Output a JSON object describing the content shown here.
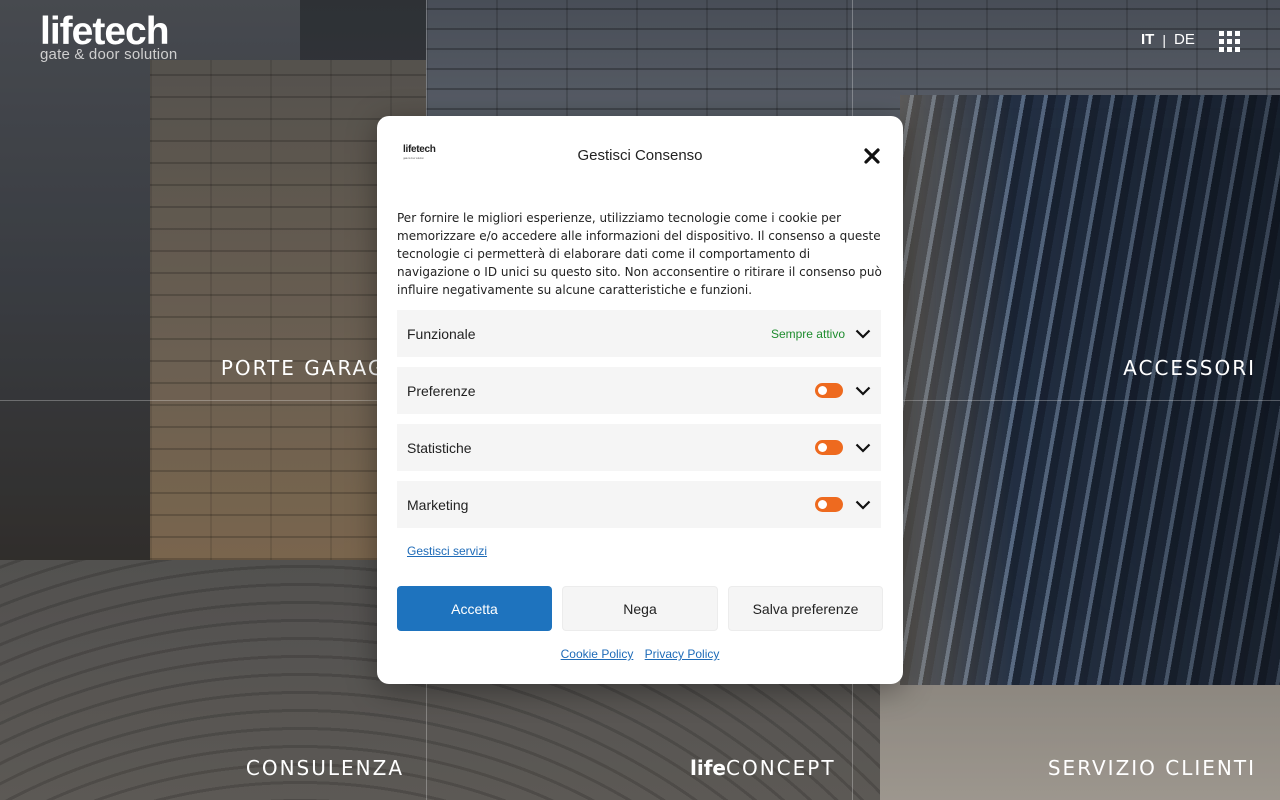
{
  "header": {
    "logo_main": "lifetech",
    "logo_sub": "gate & door solution",
    "languages": [
      "IT",
      "DE"
    ],
    "language_separator": "|",
    "active_language": "IT",
    "menu_icon": "grid-menu-icon"
  },
  "tiles": {
    "porte": "PORTE GARAGE",
    "accessori": "ACCESSORI",
    "consulenza": "CONSULENZA",
    "concept_bold": "life",
    "concept_rest": "CONCEPT",
    "servizio": "SERVIZIO CLIENTI"
  },
  "modal": {
    "logo_main": "lifetech",
    "logo_sub": "gate & door solution",
    "title": "Gestisci Consenso",
    "body": "Per fornire le migliori esperienze, utilizziamo tecnologie come i cookie per memorizzare e/o accedere alle informazioni del dispositivo. Il consenso a queste tecnologie ci permetterà di elaborare dati come il comportamento di navigazione o ID unici su questo sito. Non acconsentire o ritirare il consenso può influire negativamente su alcune caratteristiche e funzioni.",
    "categories": [
      {
        "name": "Funzionale",
        "status": "Sempre attivo"
      },
      {
        "name": "Preferenze"
      },
      {
        "name": "Statistiche"
      },
      {
        "name": "Marketing"
      }
    ],
    "manage_link": "Gestisci servizi",
    "buttons": {
      "accept": "Accetta",
      "deny": "Nega",
      "save": "Salva preferenze"
    },
    "links": {
      "cookie_policy": "Cookie Policy",
      "privacy_policy": "Privacy Policy"
    }
  },
  "colors": {
    "accent_blue": "#1e73be",
    "toggle_orange": "#ee6a1f",
    "always_active_green": "#1e8c2e"
  }
}
